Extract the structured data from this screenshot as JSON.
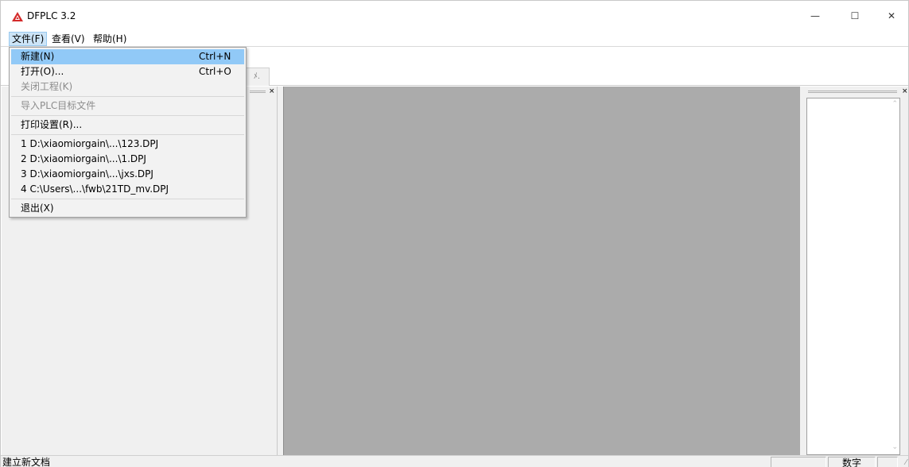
{
  "window": {
    "title": "DFPLC 3.2",
    "min_symbol": "—",
    "max_symbol": "☐",
    "close_symbol": "✕"
  },
  "menubar": {
    "items": [
      {
        "label": "文件(F)"
      },
      {
        "label": "查看(V)"
      },
      {
        "label": "帮助(H)"
      }
    ]
  },
  "file_menu": {
    "new": {
      "label": "新建(N)",
      "shortcut": "Ctrl+N"
    },
    "open": {
      "label": "打开(O)...",
      "shortcut": "Ctrl+O"
    },
    "close_project": {
      "label": "关闭工程(K)"
    },
    "import_plc": {
      "label": "导入PLC目标文件"
    },
    "print_setup": {
      "label": "打印设置(R)..."
    },
    "recent": [
      {
        "label": "1 D:\\xiaomiorgain\\...\\123.DPJ"
      },
      {
        "label": "2 D:\\xiaomiorgain\\...\\1.DPJ"
      },
      {
        "label": "3 D:\\xiaomiorgain\\...\\jxs.DPJ"
      },
      {
        "label": "4 C:\\Users\\...\\fwb\\21TD_mv.DPJ"
      }
    ],
    "exit": {
      "label": "退出(X)"
    }
  },
  "toolbar": {
    "tab_fragment": "ﾒ."
  },
  "statusbar": {
    "message": "建立新文档",
    "num_indicator": "数字"
  },
  "colors": {
    "workspace": "#ababab",
    "menu_highlight": "#91c9f7",
    "menu_active": "#cce4f7",
    "app_icon": "#d42a2a"
  }
}
